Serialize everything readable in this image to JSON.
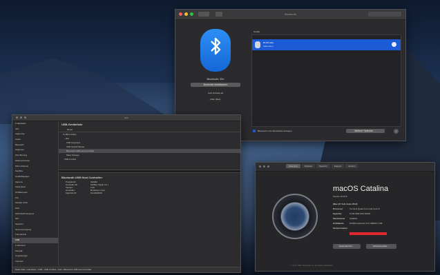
{
  "bluetooth_window": {
    "title": "Bluetooth",
    "status": "Bluetooth: Ein",
    "toggle_button": "Bluetooth deaktivieren",
    "discoverable_line1": "Jetzt sichtbar als",
    "discoverable_line2": "„iMac (Max)“",
    "devices_header": "Geräte",
    "device_name": "BT-BT-Max",
    "device_status": "Verbunden",
    "show_in_menubar": "Bluetooth in der Menüleiste anzeigen",
    "advanced_button": "Weitere Optionen …",
    "help": "?"
  },
  "sysinfo_window": {
    "title": "iMac",
    "sidebar_items": [
      "▾ Hardware",
      "ATA",
      "Apple Pay",
      "Audio",
      "Bluetooth",
      "Diagnose",
      "Disc Burning",
      "Ethernet-Karten",
      "Fibre-Channel",
      "FireWire",
      "Grafik/Displays",
      "Kamera",
      "Kartenleser",
      "NVMExpress",
      "PCI",
      "Parallel SCSI",
      "SAS",
      "SATA/SATA Express",
      "SPI",
      "Speicher",
      "Stromversorgung",
      "Thunderbolt",
      "USB",
      "▾ Netzwerk",
      "Firewall",
      "Umgebungen",
      "Volumes"
    ],
    "tree_header": "USB-Geräteliste",
    "tree_col": "Name",
    "tree_rows": [
      "▾ USB 3.0-Bus",
      "    Hub",
      "      USB Keyboard",
      "      USB Optical Mouse",
      "      Bluetooth USB Host Controller",
      "      Mass Storage",
      "  USB 2.0-Bus"
    ],
    "detail_title": "Bluetooth USB Host Controller:",
    "details": [
      {
        "k": "Produkt-ID:",
        "v": "0x8290"
      },
      {
        "k": "Hersteller-ID:",
        "v": "0x05ac (Apple Inc.)"
      },
      {
        "k": "Version:",
        "v": "1.00"
      },
      {
        "k": "Hersteller:",
        "v": "Broadcom Corp."
      },
      {
        "k": "Standort-ID:",
        "v": "0x14300000"
      }
    ],
    "breadcrumb": "Daten-Mac › Hardware › USB › USB 3.0-Bus › Hub › Bluetooth USB Host Controller"
  },
  "about_window": {
    "tabs": [
      "Übersicht",
      "Displays",
      "Speicher",
      "Support",
      "Service"
    ],
    "os_name": "macOS Catalina",
    "os_version": "Version 10.15.2",
    "specs": [
      {
        "k": "iMac (27 Zoll, Ende 2012)",
        "v": ""
      },
      {
        "k": "Prozessor",
        "v": "3,2 GHz Quad-Core Intel Core i5"
      },
      {
        "k": "Speicher",
        "v": "8 GB 1600 MHz DDR3"
      },
      {
        "k": "Startvolume",
        "v": "Catalina"
      },
      {
        "k": "Grafikkarte",
        "v": "NVIDIA GeForce GTX 680MX 2 GB"
      },
      {
        "k": "Seriennummer",
        "v": ""
      }
    ],
    "report_button": "Systembericht …",
    "update_button": "Softwareupdate …",
    "footer": "™ und © 1983–2019 Apple Inc. Alle Rechte vorbehalten."
  },
  "colors": {
    "accent": "#1b5bd6",
    "bt_blue": "#2e8ff5",
    "close": "#ff5f57",
    "min": "#febc2e",
    "max": "#28c840",
    "serial_redaction": "#e0282e"
  }
}
